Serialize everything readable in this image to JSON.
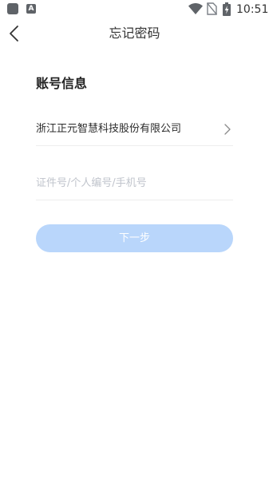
{
  "status_bar": {
    "time": "10:51",
    "a_icon_label": "A",
    "icons": [
      "notification-square-icon",
      "a-icon",
      "wifi-icon",
      "no-sim-icon",
      "battery-charging-icon"
    ]
  },
  "header": {
    "title": "忘记密码",
    "back_icon": "chevron-left-icon"
  },
  "form": {
    "section_title": "账号信息",
    "company_name": "浙江正元智慧科技股份有限公司",
    "company_chevron_icon": "chevron-right-icon",
    "id_input": {
      "value": "",
      "placeholder": "证件号/个人编号/手机号"
    },
    "next_label": "下一步"
  },
  "colors": {
    "background": "#ffffff",
    "primary_button_disabled": "#b9d6fb",
    "placeholder": "#c0c4cc",
    "divider": "#ededed"
  }
}
